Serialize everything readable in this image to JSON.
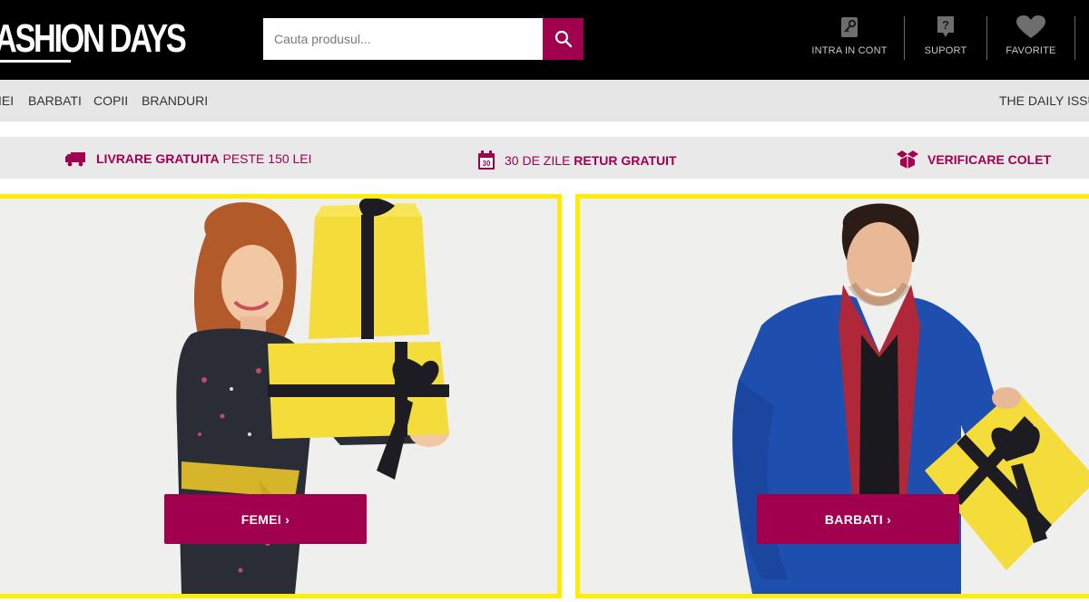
{
  "header": {
    "logo_text": "ASHION DAYS",
    "search_placeholder": "Cauta produsul...",
    "actions": {
      "account": "INTRA IN CONT",
      "support": "SUPORT",
      "favorites": "FAVORITE"
    }
  },
  "nav": {
    "items": [
      "IEI",
      "BARBATI",
      "COPII",
      "BRANDURI"
    ],
    "right_item": "THE DAILY ISSU"
  },
  "benefits": [
    {
      "bold": "LIVRARE GRATUITA",
      "normal": "PESTE 150 LEI",
      "icon": "truck-icon"
    },
    {
      "normal": "30 DE ZILE",
      "bold": "RETUR GRATUIT",
      "icon": "calendar-30-icon",
      "icon_text": "30"
    },
    {
      "bold": "VERIFICARE COLET",
      "icon": "open-box-icon"
    }
  ],
  "cards": [
    {
      "cta": "FEMEI ›"
    },
    {
      "cta": "BARBATI ›"
    }
  ],
  "colors": {
    "brand": "#a0004e",
    "frame": "#ffec00",
    "header_bg": "#000000",
    "nav_bg": "#e6e6e6"
  }
}
